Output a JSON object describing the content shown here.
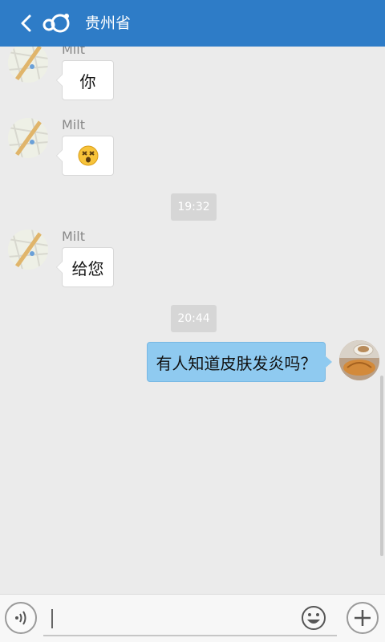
{
  "header": {
    "title": "贵州省",
    "back_icon": "chevron-left-icon",
    "logo_icon": "app-logo-icon",
    "color": "#2e7cc7"
  },
  "messages": [
    {
      "sender": "Milt",
      "text": "你"
    },
    {
      "sender": "Milt",
      "text": "",
      "emoji": "dizzy-face-emoji"
    },
    {
      "time": "19:32"
    },
    {
      "sender": "Milt",
      "text": "给您"
    },
    {
      "time": "20:44"
    },
    {
      "sender": "me",
      "text": "有人知道皮肤发炎吗？"
    }
  ],
  "input_bar": {
    "voice_icon": "voice-icon",
    "emoji_icon": "smiley-icon",
    "plus_icon": "plus-icon",
    "value": "",
    "placeholder": ""
  }
}
